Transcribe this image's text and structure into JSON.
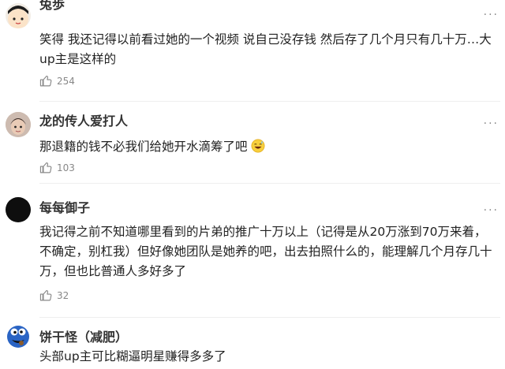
{
  "comments": [
    {
      "username": "兔歩",
      "text": "笑得 我还记得以前看过她的一个视频 说自己没存钱 然后存了几个月只有几十万…大up主是这样的",
      "likes": "254"
    },
    {
      "username": "龙的传人爱打人",
      "text": "那退籍的钱不必我们给她开水滴筹了吧",
      "emoji": "laughing-sweat-emoji",
      "likes": "103"
    },
    {
      "username": "每每御子",
      "text": "我记得之前不知道哪里看到的片弟的推广十万以上（记得是从20万涨到70万来着，不确定，别杠我）但好像她团队是她养的吧，出去拍照什么的，能理解几个月存几十万，但也比普通人多好多了",
      "likes": "32"
    },
    {
      "username": "饼干怪（减肥）",
      "text": "头部up主可比糊逼明星赚得多多了",
      "likes": ""
    }
  ],
  "more_glyph": "···",
  "colors": {
    "text": "#222222",
    "muted": "#888888",
    "divider": "#eeeeee"
  }
}
